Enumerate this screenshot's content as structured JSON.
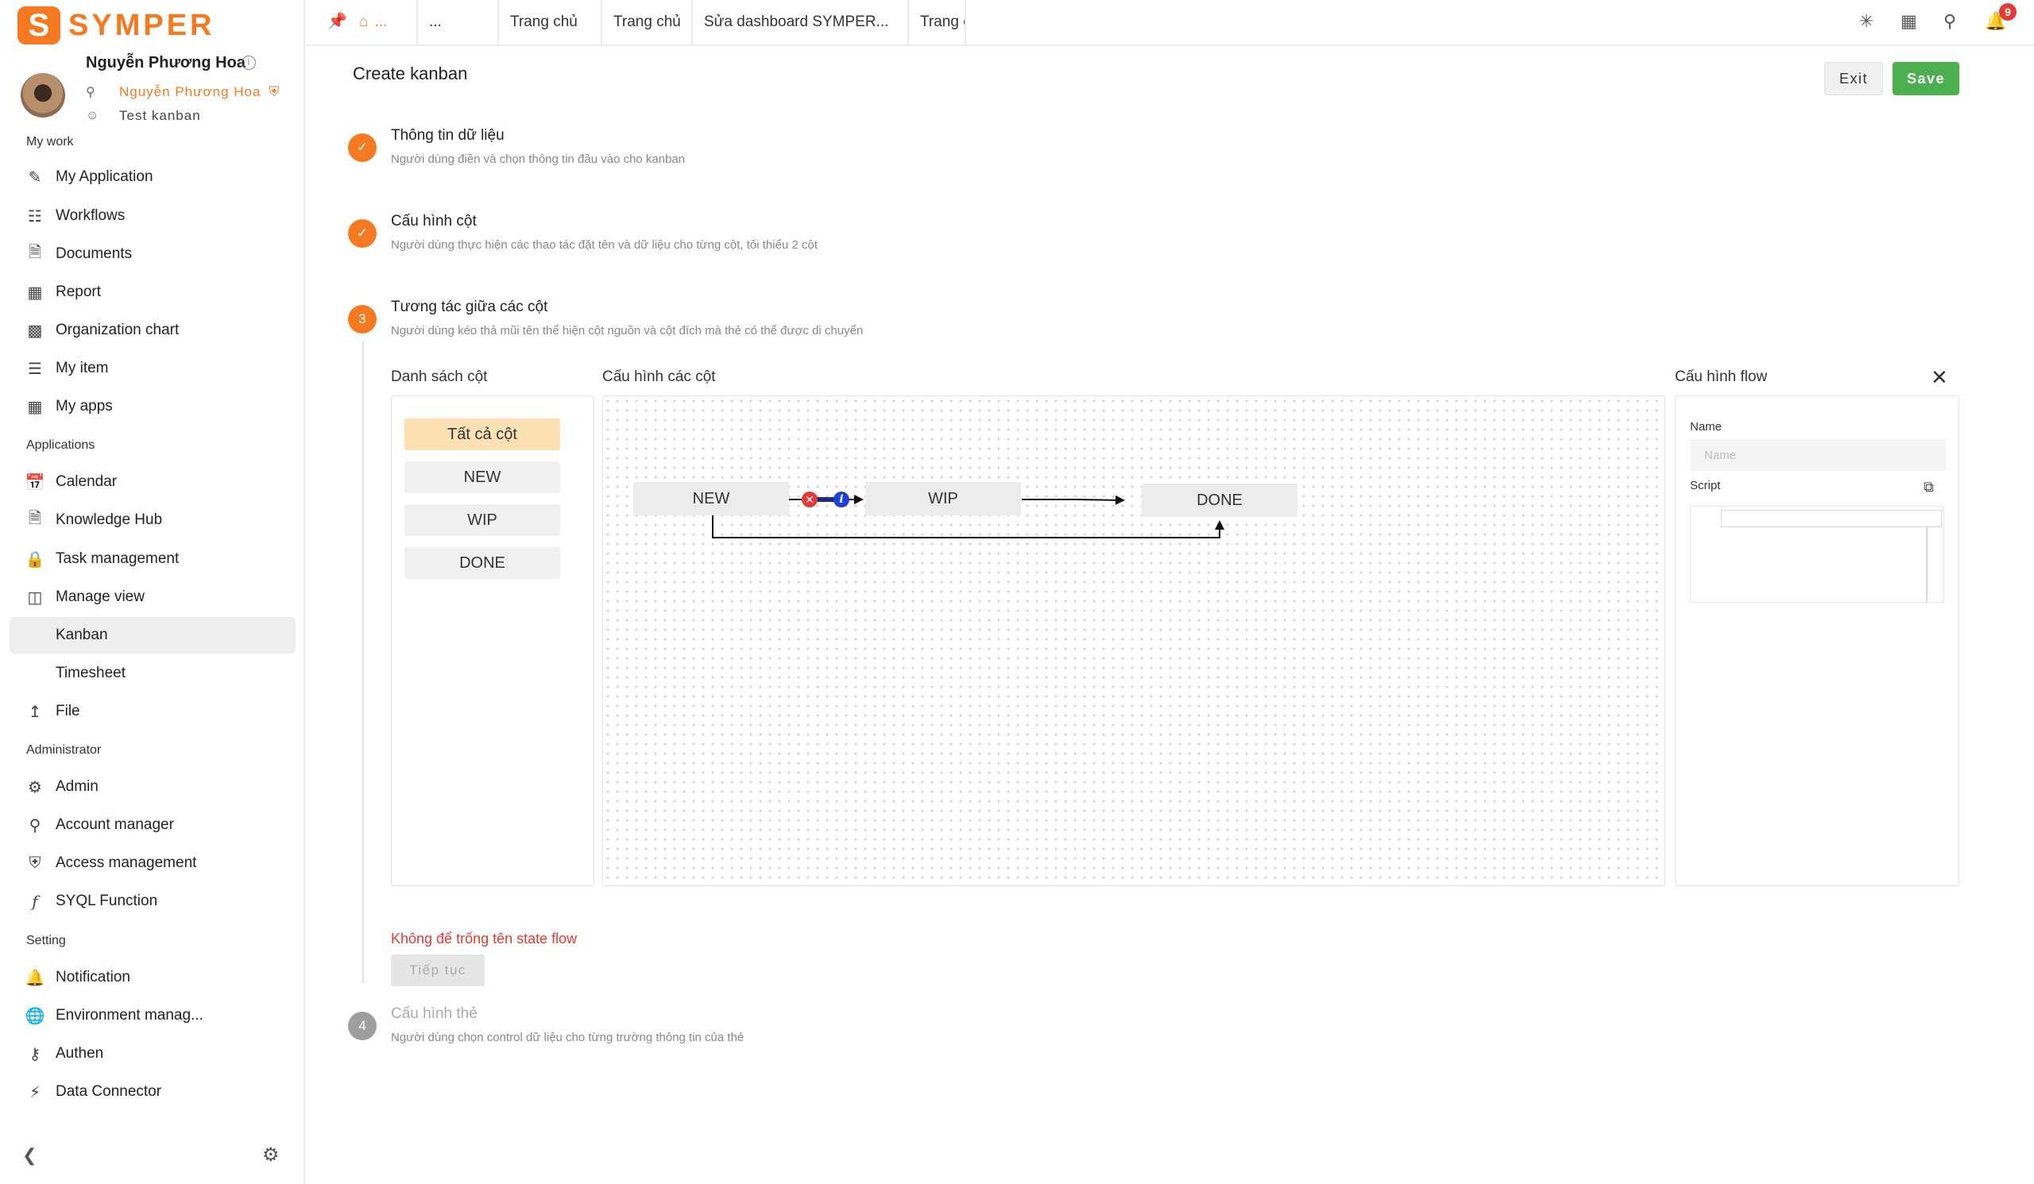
{
  "brand": {
    "logo_letter": "S",
    "name": "SYMPER",
    "accent_color": "#f47920"
  },
  "user": {
    "name": "Nguyễn Phương Hoa",
    "role": "Nguyễn Phương Hoa",
    "app": "Test kanban"
  },
  "sidebar": {
    "sections": {
      "my_work": "My work",
      "applications": "Applications",
      "administrator": "Administrator",
      "setting": "Setting"
    },
    "items": [
      {
        "label": "My Application",
        "icon": "application-icon"
      },
      {
        "label": "Workflows",
        "icon": "workflow-icon"
      },
      {
        "label": "Documents",
        "icon": "document-icon"
      },
      {
        "label": "Report",
        "icon": "report-icon"
      },
      {
        "label": "Organization chart",
        "icon": "org-chart-icon"
      },
      {
        "label": "My item",
        "icon": "list-icon"
      },
      {
        "label": "My apps",
        "icon": "apps-icon"
      },
      {
        "label": "Calendar",
        "icon": "calendar-icon"
      },
      {
        "label": "Knowledge Hub",
        "icon": "knowledge-icon"
      },
      {
        "label": "Task management",
        "icon": "lock-icon"
      },
      {
        "label": "Manage view",
        "icon": "view-icon"
      },
      {
        "label": "Kanban",
        "icon": ""
      },
      {
        "label": "Timesheet",
        "icon": ""
      },
      {
        "label": "File",
        "icon": "upload-icon"
      },
      {
        "label": "Admin",
        "icon": "gear-icon"
      },
      {
        "label": "Account manager",
        "icon": "account-icon"
      },
      {
        "label": "Access management",
        "icon": "shield-icon"
      },
      {
        "label": "SYQL Function",
        "icon": "function-icon"
      },
      {
        "label": "Notification",
        "icon": "bell-icon"
      },
      {
        "label": "Environment manag...",
        "icon": "globe-icon"
      },
      {
        "label": "Authen",
        "icon": "key-icon"
      },
      {
        "label": "Data Connector",
        "icon": "plug-icon"
      }
    ],
    "active_item": "Kanban"
  },
  "tabs": [
    {
      "label": "...",
      "icon": "home-icon"
    },
    {
      "label": "..."
    },
    {
      "label": "Trang chủ"
    },
    {
      "label": "Trang chủ"
    },
    {
      "label": "Sửa dashboard SYMPER..."
    },
    {
      "label": "Trang c"
    }
  ],
  "notifications": {
    "count": "9"
  },
  "page": {
    "title": "Create kanban",
    "exit_label": "Exit",
    "save_label": "Save"
  },
  "steps": [
    {
      "number": "1",
      "title": "Thông tin dữ liệu",
      "desc": "Người dùng điền và chọn thông tin đầu vào cho kanban",
      "status": "done"
    },
    {
      "number": "2",
      "title": "Cấu hình cột",
      "desc": "Người dùng thực hiện các thao tác đặt tên và dữ liệu cho từng cột, tối thiểu 2 cột",
      "status": "done"
    },
    {
      "number": "3",
      "title": "Tương tác giữa các cột",
      "desc": "Người dùng kéo thả mũi tên thể hiện cột nguồn và cột đích mà thẻ có thể được di chuyển",
      "status": "current"
    },
    {
      "number": "4",
      "title": "Cấu hình thẻ",
      "desc": "Người dùng chọn control dữ liệu cho từng trường thông tin của thẻ",
      "status": "pending"
    }
  ],
  "columns_panel": {
    "label": "Danh sách cột",
    "items": [
      "Tất cả cột",
      "NEW",
      "WIP",
      "DONE"
    ]
  },
  "canvas": {
    "label": "Cấu hình các cột",
    "nodes": [
      "NEW",
      "WIP",
      "DONE"
    ]
  },
  "flow_config": {
    "label": "Cấu hình flow",
    "name_label": "Name",
    "name_placeholder": "Name",
    "name_value": "",
    "script_label": "Script"
  },
  "validation": {
    "error": "Không để trống tên state flow",
    "continue_label": "Tiếp tục"
  }
}
